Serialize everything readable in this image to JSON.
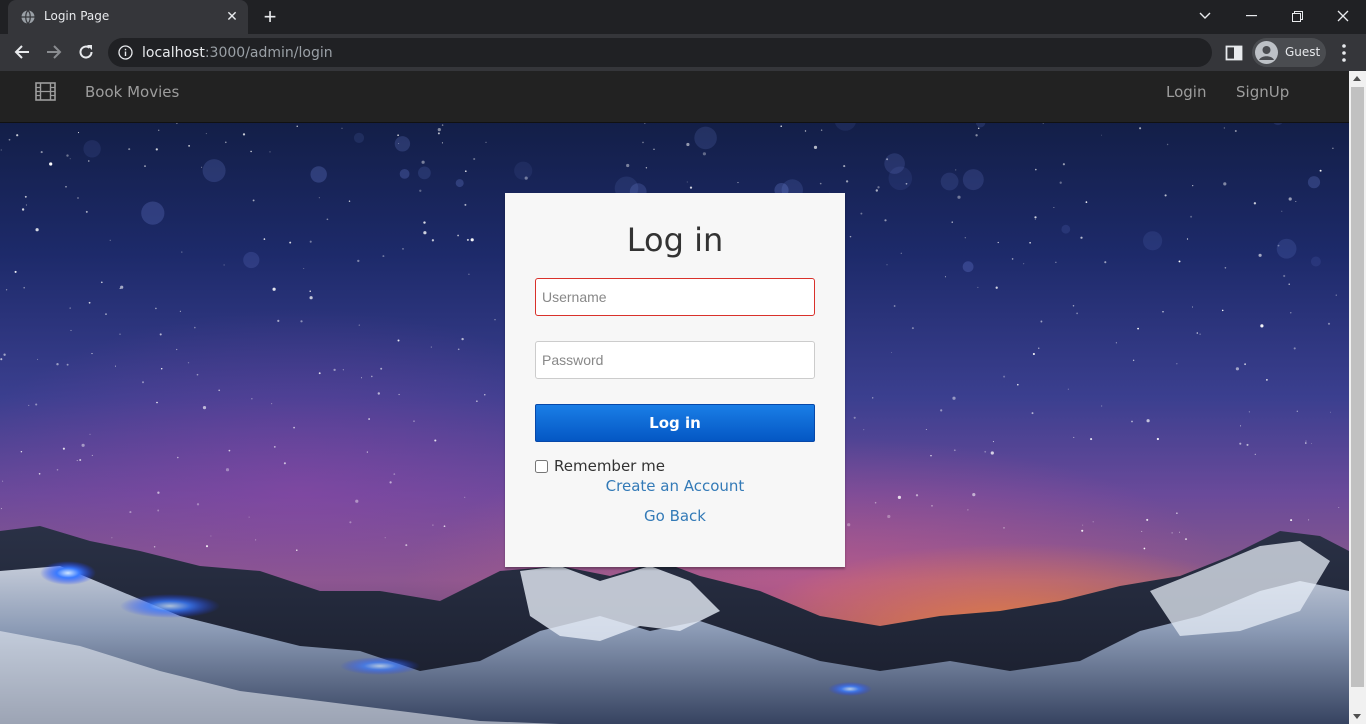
{
  "browser": {
    "tab_title": "Login Page",
    "url_host": "localhost",
    "url_path": ":3000/admin/login",
    "profile_label": "Guest"
  },
  "navbar": {
    "brand": "Book Movies",
    "links": [
      "Login",
      "SignUp"
    ]
  },
  "login_form": {
    "title": "Log in",
    "username_placeholder": "Username",
    "password_placeholder": "Password",
    "submit_label": "Log in",
    "remember_label": "Remember me",
    "remember_checked": false,
    "create_account_link": "Create an Account",
    "go_back_link": "Go Back"
  },
  "colors": {
    "primary_button": "#0a66d4",
    "link": "#337ab7",
    "invalid_border": "#d9312b",
    "navbar_bg": "#222222",
    "card_bg": "#f7f7f7"
  }
}
